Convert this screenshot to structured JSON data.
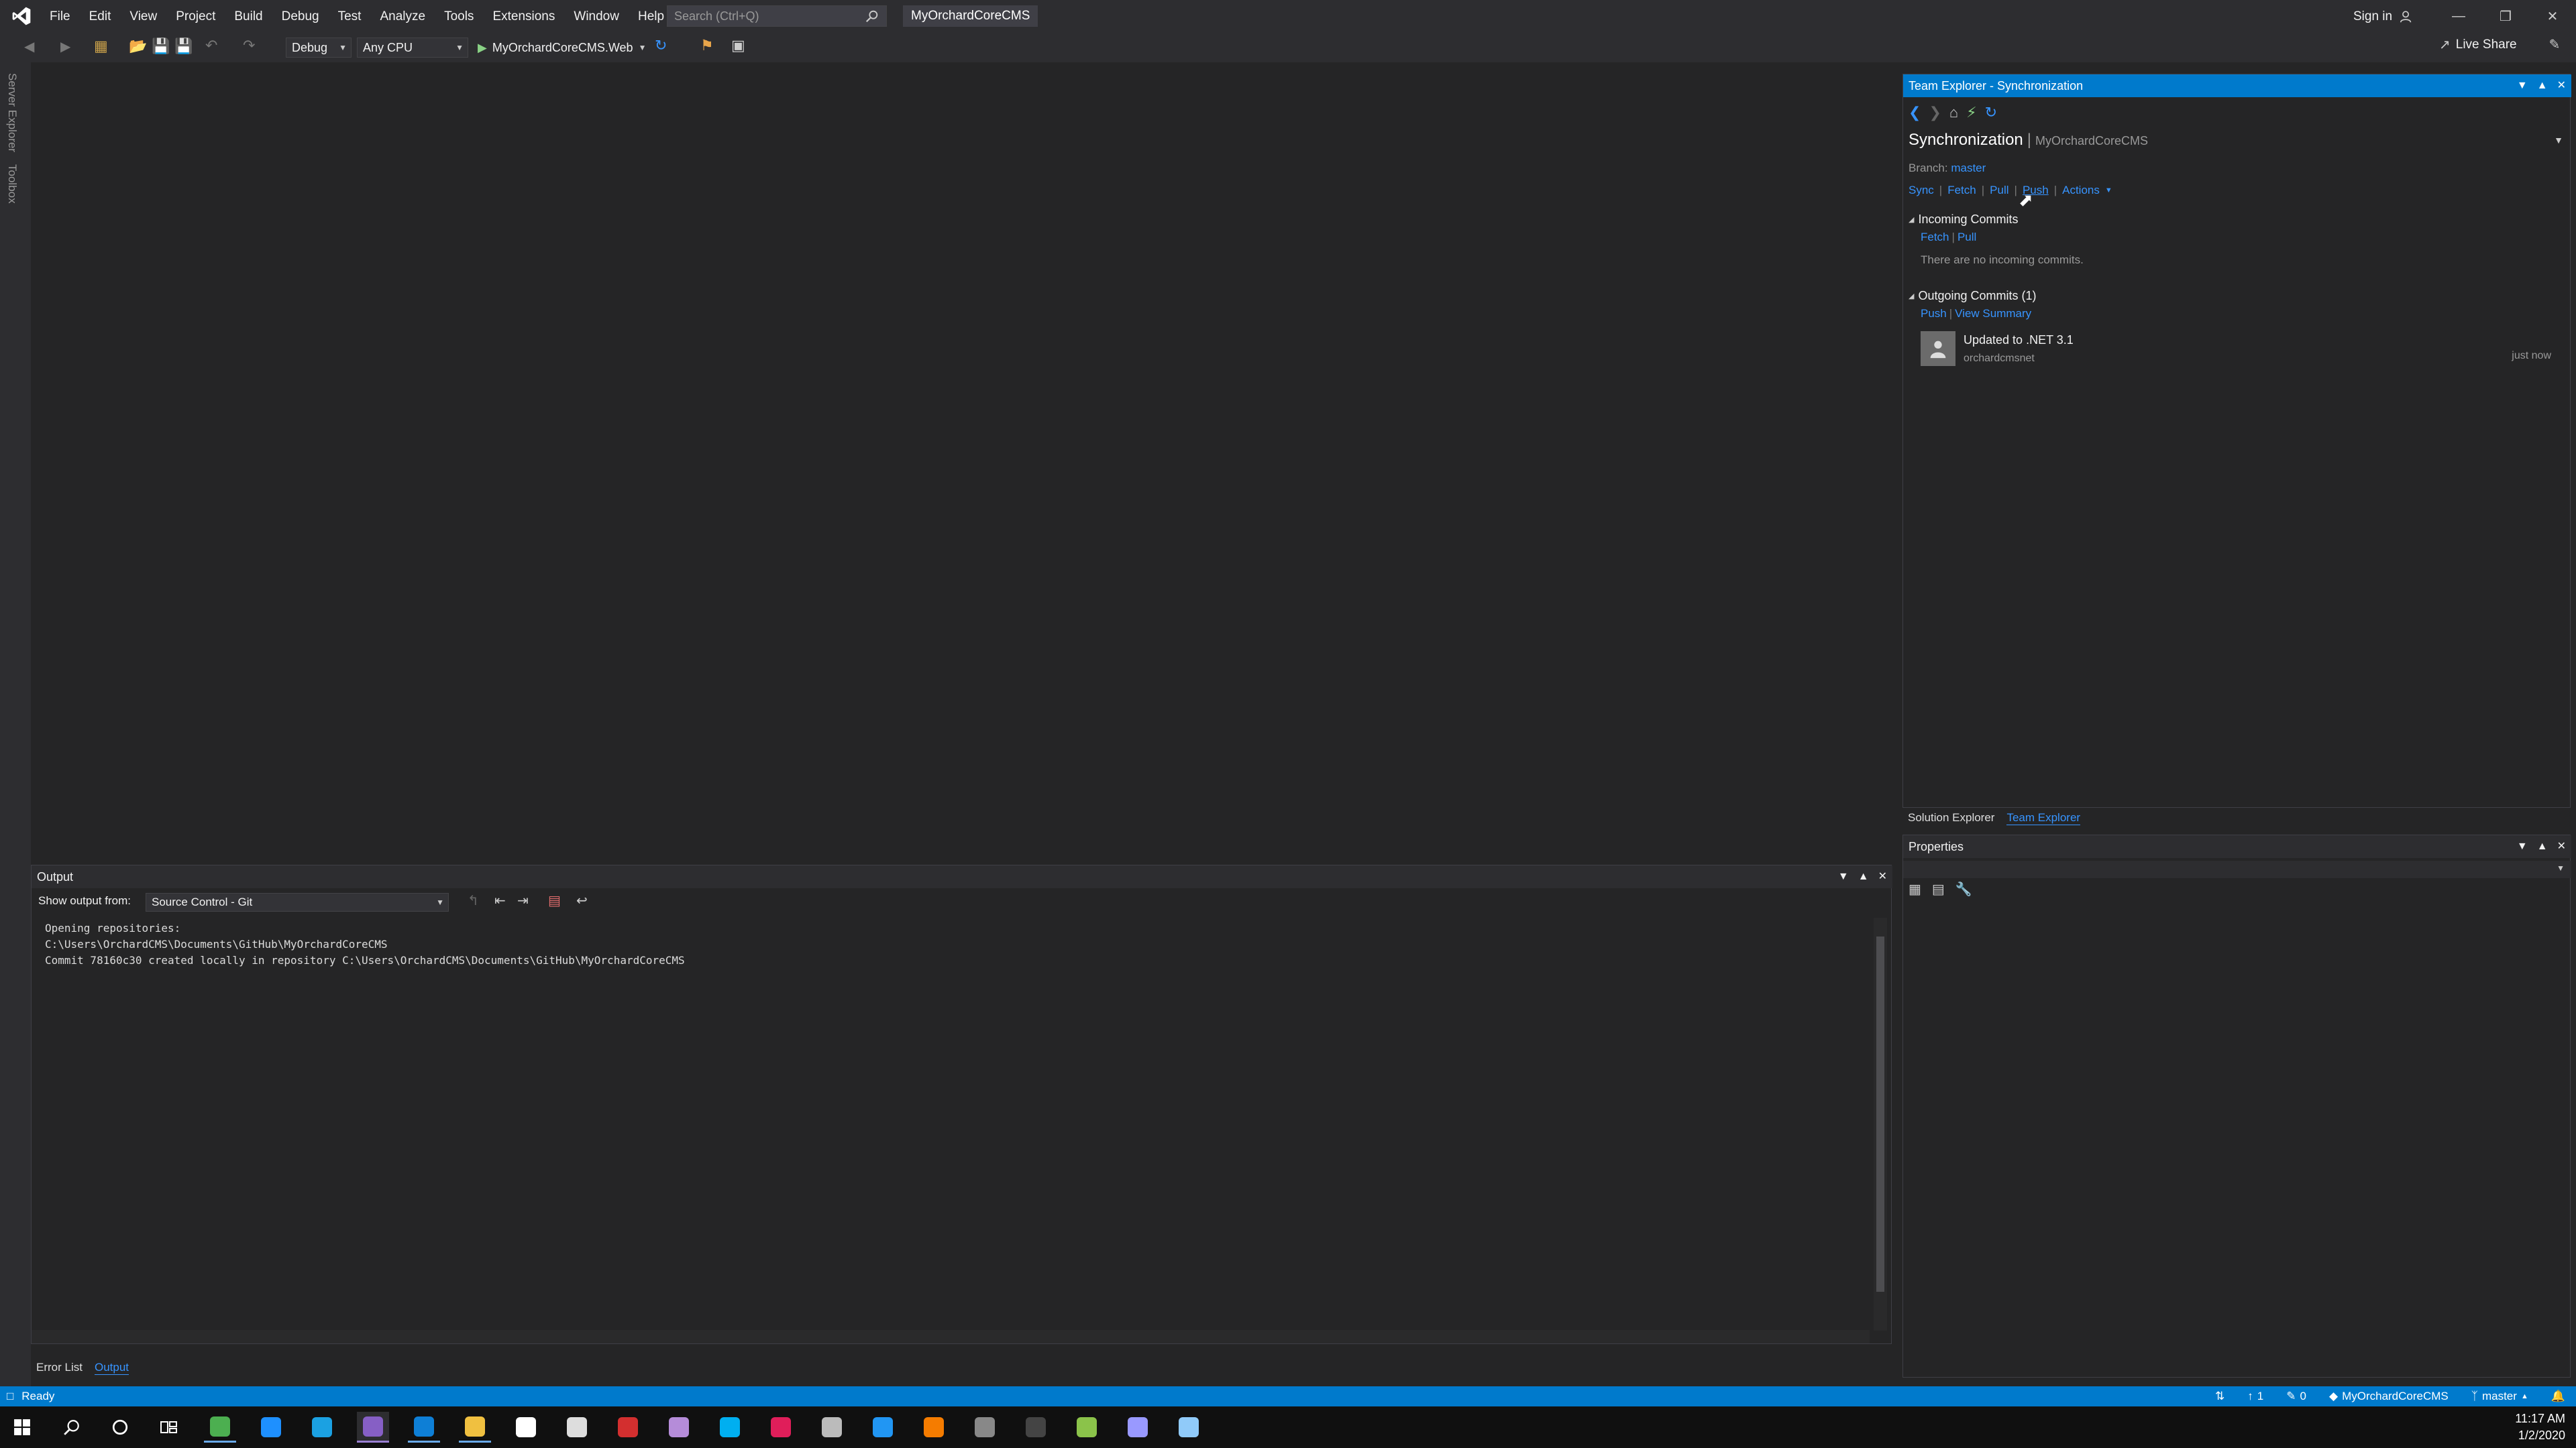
{
  "window": {
    "menu": [
      "File",
      "Edit",
      "View",
      "Project",
      "Build",
      "Debug",
      "Test",
      "Analyze",
      "Tools",
      "Extensions",
      "Window",
      "Help"
    ],
    "search_placeholder": "Search (Ctrl+Q)",
    "solution_name": "MyOrchardCoreCMS",
    "signin_label": "Sign in"
  },
  "toolbar": {
    "config": "Debug",
    "platform": "Any CPU",
    "startup_project": "MyOrchardCoreCMS.Web",
    "liveshare_label": "Live Share"
  },
  "left_strip": {
    "tabs": [
      "Server Explorer",
      "Toolbox"
    ]
  },
  "team_explorer": {
    "header": "Team Explorer - Synchronization",
    "title": "Synchronization",
    "repo": "MyOrchardCoreCMS",
    "branch_label": "Branch:",
    "branch_value": "master",
    "actions": [
      "Sync",
      "Fetch",
      "Pull",
      "Push",
      "Actions"
    ],
    "incoming": {
      "title": "Incoming Commits",
      "links": [
        "Fetch",
        "Pull"
      ],
      "empty_text": "There are no incoming commits."
    },
    "outgoing": {
      "title": "Outgoing Commits (1)",
      "links": [
        "Push",
        "View Summary"
      ],
      "commit_message": "Updated to .NET 3.1",
      "commit_author": "orchardcmsnet",
      "commit_time": "just now"
    }
  },
  "solution_tabs": [
    "Solution Explorer",
    "Team Explorer"
  ],
  "properties": {
    "header": "Properties"
  },
  "output": {
    "header": "Output",
    "show_from_label": "Show output from:",
    "source": "Source Control - Git",
    "lines": "Opening repositories:\nC:\\Users\\OrchardCMS\\Documents\\GitHub\\MyOrchardCoreCMS\nCommit 78160c30 created locally in repository C:\\Users\\OrchardCMS\\Documents\\GitHub\\MyOrchardCoreCMS"
  },
  "bottom_tabs": [
    "Error List",
    "Output"
  ],
  "status": {
    "state": "Ready",
    "up_count": "1",
    "pencil_count": "0",
    "repo": "MyOrchardCoreCMS",
    "branch": "master"
  },
  "taskbar": {
    "time": "11:17 AM",
    "date": "1/2/2020",
    "apps": [
      {
        "name": "chrome-icon",
        "color": "#4caf50"
      },
      {
        "name": "edge-icon",
        "color": "#1e90ff"
      },
      {
        "name": "ie-icon",
        "color": "#1ba1e2"
      },
      {
        "name": "visual-studio-icon",
        "color": "#865fc5"
      },
      {
        "name": "vscode-icon",
        "color": "#0e7fd6"
      },
      {
        "name": "file-explorer-icon",
        "color": "#f0c040"
      },
      {
        "name": "store-icon",
        "color": "#ffffff"
      },
      {
        "name": "mail-icon",
        "color": "#dddddd"
      },
      {
        "name": "app-red-icon",
        "color": "#d32f2f"
      },
      {
        "name": "github-icon",
        "color": "#b58cd9"
      },
      {
        "name": "skype-icon",
        "color": "#00aff0"
      },
      {
        "name": "slack-icon",
        "color": "#e01e5a"
      },
      {
        "name": "clock-app-icon",
        "color": "#bbbbbb"
      },
      {
        "name": "app-blue-icon",
        "color": "#2196f3"
      },
      {
        "name": "paint-icon",
        "color": "#f57c00"
      },
      {
        "name": "tool-icon",
        "color": "#888888"
      },
      {
        "name": "terminal-icon",
        "color": "#444444"
      },
      {
        "name": "app-green-icon",
        "color": "#8bc34a"
      },
      {
        "name": "premiere-icon",
        "color": "#9999ff"
      },
      {
        "name": "notepad-icon",
        "color": "#90caf9"
      }
    ]
  }
}
